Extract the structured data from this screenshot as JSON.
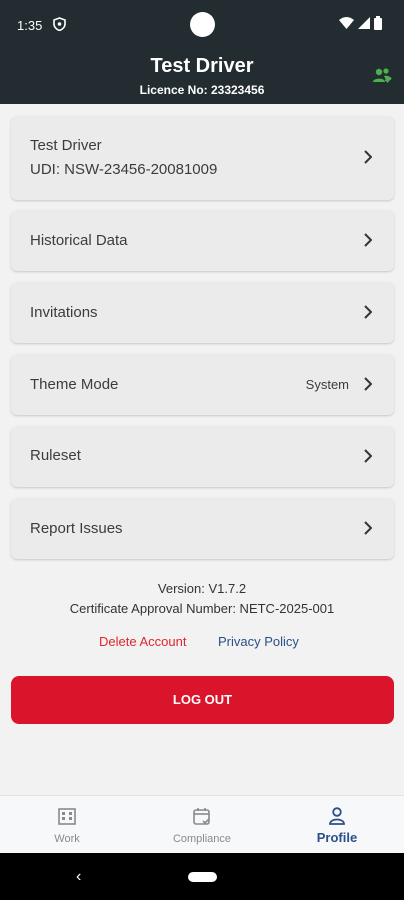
{
  "status_bar": {
    "time": "1:35"
  },
  "header": {
    "title": "Test Driver",
    "subtitle": "Licence No: 23323456"
  },
  "menu": {
    "profile": {
      "name": "Test Driver",
      "udi": "UDI: NSW-23456-20081009"
    },
    "historical": "Historical Data",
    "invitations": "Invitations",
    "theme": {
      "label": "Theme Mode",
      "value": "System"
    },
    "ruleset": "Ruleset",
    "report": "Report Issues"
  },
  "footer": {
    "version": "Version: V1.7.2",
    "certificate": "Certificate Approval Number: NETC-2025-001",
    "delete_account": "Delete Account",
    "privacy_policy": "Privacy Policy",
    "logout": "LOG OUT"
  },
  "bottom_nav": {
    "work": "Work",
    "compliance": "Compliance",
    "profile": "Profile"
  },
  "colors": {
    "header_bg": "#222c31",
    "accent_blue": "#2c4f88",
    "danger_red": "#d9142b",
    "sync_green": "#4caf50"
  }
}
